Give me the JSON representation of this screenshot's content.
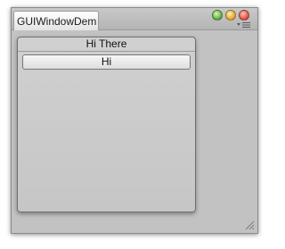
{
  "window": {
    "tab_label": "GUIWindowDem",
    "colors": {
      "close": "#dd4a3d",
      "minimize": "#e0a12a",
      "zoom": "#5aa83a"
    }
  },
  "toolbar": {
    "menu_icon": "menu-lines-icon"
  },
  "gui_window": {
    "title": "Hi There",
    "button_label": "Hi"
  },
  "footer": {
    "resize_icon": "resize-grip-icon"
  }
}
